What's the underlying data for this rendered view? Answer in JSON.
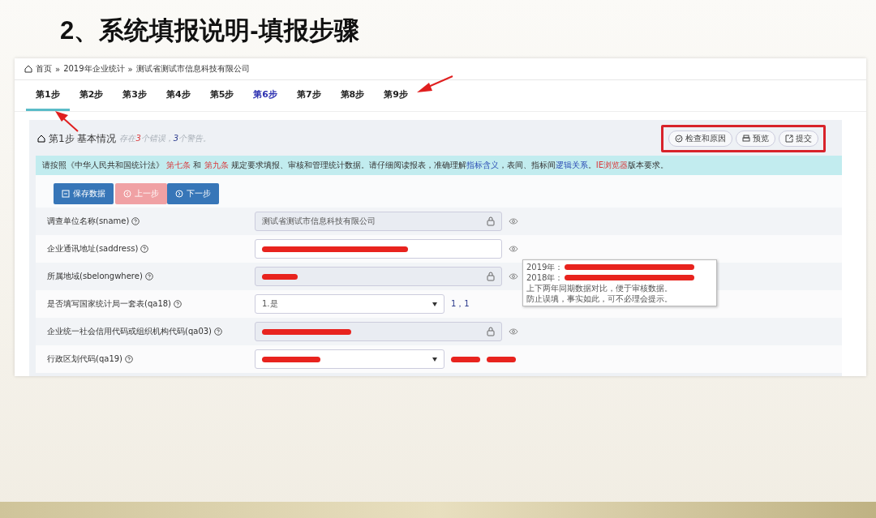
{
  "slide_title": "2、系统填报说明-填报步骤",
  "breadcrumb": [
    {
      "label": "首页",
      "kind": "home"
    },
    {
      "label": "2019年企业统计",
      "kind": "link"
    },
    {
      "label": "测试省测试市信息科技有限公司",
      "kind": "link"
    }
  ],
  "breadcrumb_separator": "»",
  "tabs": [
    {
      "label": "第1步",
      "selected": true,
      "highlighted": false
    },
    {
      "label": "第2步",
      "selected": false,
      "highlighted": false
    },
    {
      "label": "第3步",
      "selected": false,
      "highlighted": false
    },
    {
      "label": "第4步",
      "selected": false,
      "highlighted": false
    },
    {
      "label": "第5步",
      "selected": false,
      "highlighted": false
    },
    {
      "label": "第6步",
      "selected": false,
      "highlighted": true
    },
    {
      "label": "第7步",
      "selected": false,
      "highlighted": false
    },
    {
      "label": "第8步",
      "selected": false,
      "highlighted": false
    },
    {
      "label": "第9步",
      "selected": false,
      "highlighted": false
    }
  ],
  "section": {
    "title": "第1步 基本情况",
    "status": [
      {
        "text": "存在",
        "kind": "plain"
      },
      {
        "text": "3",
        "kind": "error"
      },
      {
        "text": "个错误，",
        "kind": "plain"
      },
      {
        "text": "3",
        "kind": "warning"
      },
      {
        "text": "个警告。",
        "kind": "plain"
      }
    ],
    "actions": [
      {
        "label": "检查和原因"
      },
      {
        "label": "预览"
      },
      {
        "label": "提交"
      }
    ]
  },
  "notice": [
    {
      "text": "请按照《中华人民共和国统计法》 ",
      "kind": "plain"
    },
    {
      "text": "第七条",
      "kind": "alert"
    },
    {
      "text": " 和 ",
      "kind": "plain"
    },
    {
      "text": "第九条",
      "kind": "alert"
    },
    {
      "text": " 规定要求填报、审核和管理统计数据。请仔细阅读报表，准确理解",
      "kind": "plain"
    },
    {
      "text": "指标含义",
      "kind": "link"
    },
    {
      "text": "，表间、指标间",
      "kind": "plain"
    },
    {
      "text": "逻辑关系",
      "kind": "link"
    },
    {
      "text": "。",
      "kind": "plain"
    },
    {
      "text": "IE浏览器",
      "kind": "alert"
    },
    {
      "text": "版本要求。",
      "kind": "plain"
    }
  ],
  "toolbar": [
    {
      "label": "保存数据",
      "disabled": false
    },
    {
      "label": "上一步",
      "disabled": true
    },
    {
      "label": "下一步",
      "disabled": false
    }
  ],
  "fields": [
    {
      "label": "调查单位名称(sname)",
      "kind": "locked",
      "value": "测试省测试市信息科技有限公司",
      "redacted": false,
      "eye": true
    },
    {
      "label": "企业通讯地址(saddress)",
      "kind": "input",
      "redacted": true,
      "eye": true
    },
    {
      "label": "所属地域(sbelongwhere)",
      "kind": "locked",
      "redacted": true,
      "eye": true
    },
    {
      "label": "是否填写国家统计局一套表(qa18)",
      "kind": "select",
      "value": "1.是",
      "redacted": false,
      "eye": false,
      "extra": [
        {
          "text": "1，1",
          "redacted": false
        }
      ]
    },
    {
      "label": "企业统一社会信用代码或组织机构代码(qa03)",
      "kind": "locked",
      "redacted": true,
      "eye": true
    },
    {
      "label": "行政区划代码(qa19)",
      "kind": "select",
      "redacted": true,
      "eye": false,
      "extra": [
        {
          "redacted": true
        },
        {
          "redacted": true
        }
      ]
    }
  ],
  "tooltip": [
    {
      "text": "2019年：",
      "redacted": true
    },
    {
      "text": "2018年：",
      "redacted": true
    },
    {
      "text": "上下两年同期数据对比，便于审核数据。",
      "redacted": false
    },
    {
      "text": "防止误填，事实如此，可不必理会提示。",
      "redacted": false
    }
  ]
}
